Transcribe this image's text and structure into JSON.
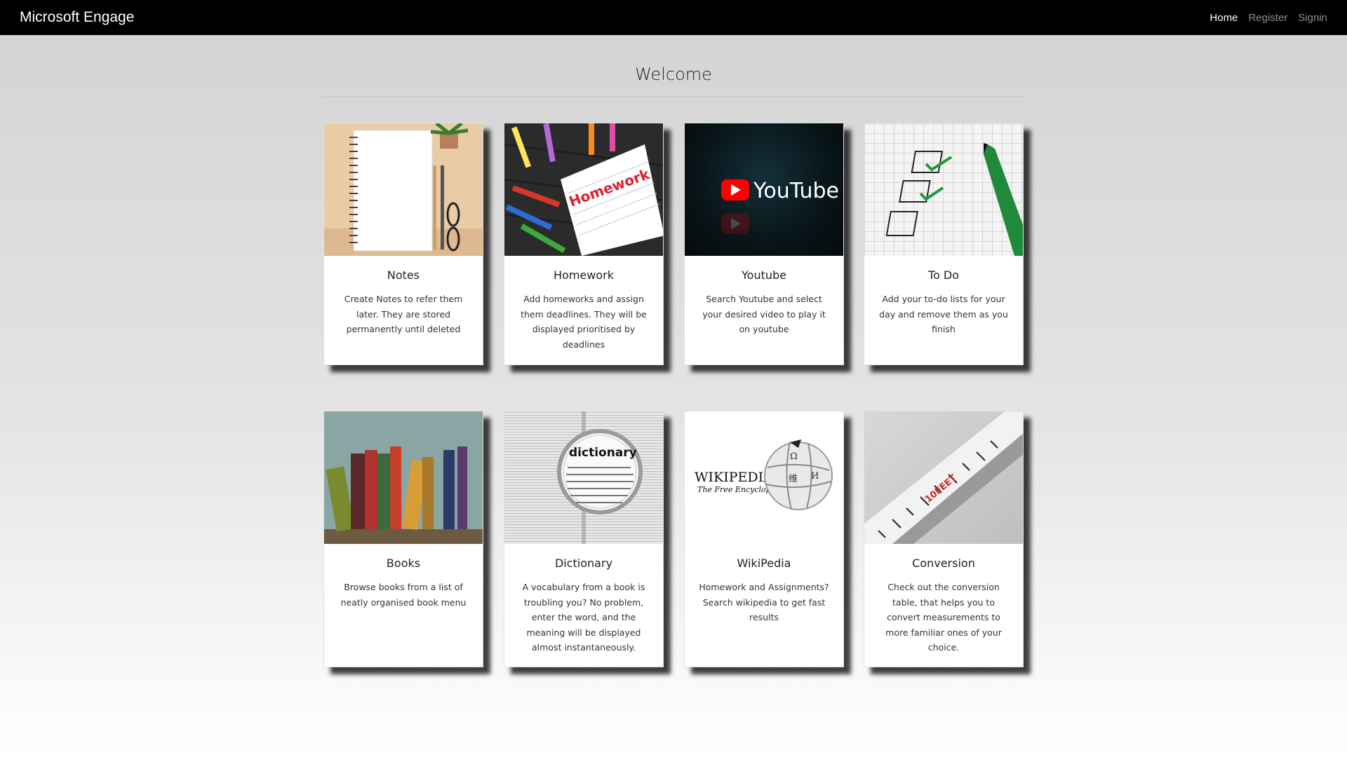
{
  "navbar": {
    "brand": "Microsoft Engage",
    "links": [
      {
        "label": "Home",
        "active": true
      },
      {
        "label": "Register",
        "active": false
      },
      {
        "label": "Signin",
        "active": false
      }
    ]
  },
  "page": {
    "title": "Welcome"
  },
  "cards": [
    {
      "title": "Notes",
      "text": "Create Notes to refer them later. They are stored permanently until deleted",
      "image": "notebook-image"
    },
    {
      "title": "Homework",
      "text": "Add homeworks and assign them deadlines. They will be displayed prioritised by deadlines",
      "image": "homework-notepad-image",
      "image_text": "Homework"
    },
    {
      "title": "Youtube",
      "text": "Search Youtube and select your desired video to play it on youtube",
      "image": "youtube-logo-image",
      "image_text": "YouTube"
    },
    {
      "title": "To Do",
      "text": "Add your to-do lists for your day and remove them as you finish",
      "image": "checklist-image"
    },
    {
      "title": "Books",
      "text": "Browse books from a list of neatly organised book menu",
      "image": "bookshelf-image"
    },
    {
      "title": "Dictionary",
      "text": "A vocabulary from a book is troubling you? No problem, enter the word, and the meaning will be displayed almost instantaneously.",
      "image": "dictionary-magnifier-image",
      "image_text": "dictionary"
    },
    {
      "title": "WikiPedia",
      "text": "Homework and Assignments? Search wikipedia to get fast results",
      "image": "wikipedia-logo-image",
      "image_text": "WIKIPEDIA",
      "image_subtext": "The Free Encyclopedia"
    },
    {
      "title": "Conversion",
      "text": "Check out the conversion table, that helps you to convert measurements to more familiar ones of your choice.",
      "image": "measuring-tape-image",
      "image_text": "10FEET"
    }
  ],
  "colors": {
    "navbar": "#000000",
    "nav_active": "#ffffff",
    "nav_inactive": "#8c8c8c",
    "youtube_red": "#ff0000"
  }
}
